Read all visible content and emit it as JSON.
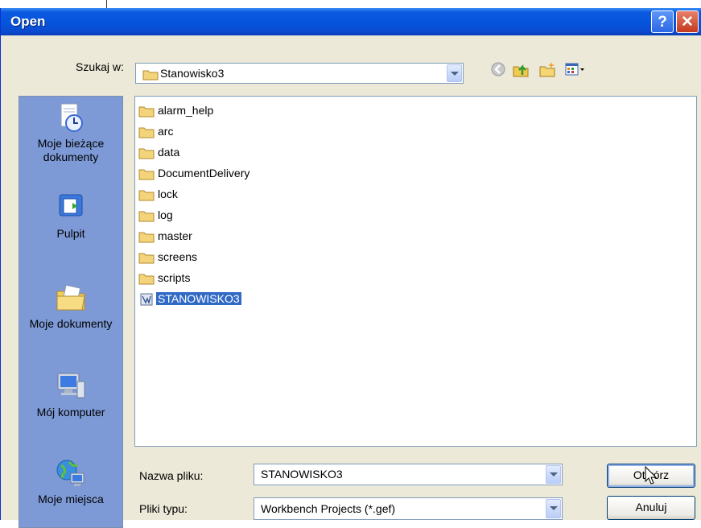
{
  "title": "Open",
  "look_in": {
    "label": "Szukaj w:",
    "value": "Stanowisko3"
  },
  "toolbar": {
    "back": "back-icon",
    "up": "up-folder-icon",
    "new_folder": "new-folder-icon",
    "views": "views-menu-icon"
  },
  "places": [
    {
      "label": "Moje bieżące dokumenty",
      "icon": "recent-documents-icon"
    },
    {
      "label": "Pulpit",
      "icon": "desktop-icon"
    },
    {
      "label": "Moje dokumenty",
      "icon": "my-documents-icon"
    },
    {
      "label": "Mój komputer",
      "icon": "my-computer-icon"
    },
    {
      "label": "Moje miejsca",
      "icon": "network-places-icon"
    }
  ],
  "files": [
    {
      "name": "alarm_help",
      "type": "folder"
    },
    {
      "name": "arc",
      "type": "folder"
    },
    {
      "name": "data",
      "type": "folder"
    },
    {
      "name": "DocumentDelivery",
      "type": "folder"
    },
    {
      "name": "lock",
      "type": "folder"
    },
    {
      "name": "log",
      "type": "folder"
    },
    {
      "name": "master",
      "type": "folder"
    },
    {
      "name": "screens",
      "type": "folder"
    },
    {
      "name": "scripts",
      "type": "folder"
    },
    {
      "name": "STANOWISKO3",
      "type": "project",
      "selected": true
    }
  ],
  "filename": {
    "label": "Nazwa pliku:",
    "value": "STANOWISKO3"
  },
  "filetype": {
    "label": "Pliki typu:",
    "value": "Workbench Projects (*.gef)"
  },
  "buttons": {
    "open": "Otwórz",
    "cancel": "Anuluj"
  },
  "colors": {
    "titlebar": "#0654dc",
    "selection": "#316ac5",
    "places_bar": "#7d9ad6",
    "dialog_bg": "#ece9d8"
  }
}
